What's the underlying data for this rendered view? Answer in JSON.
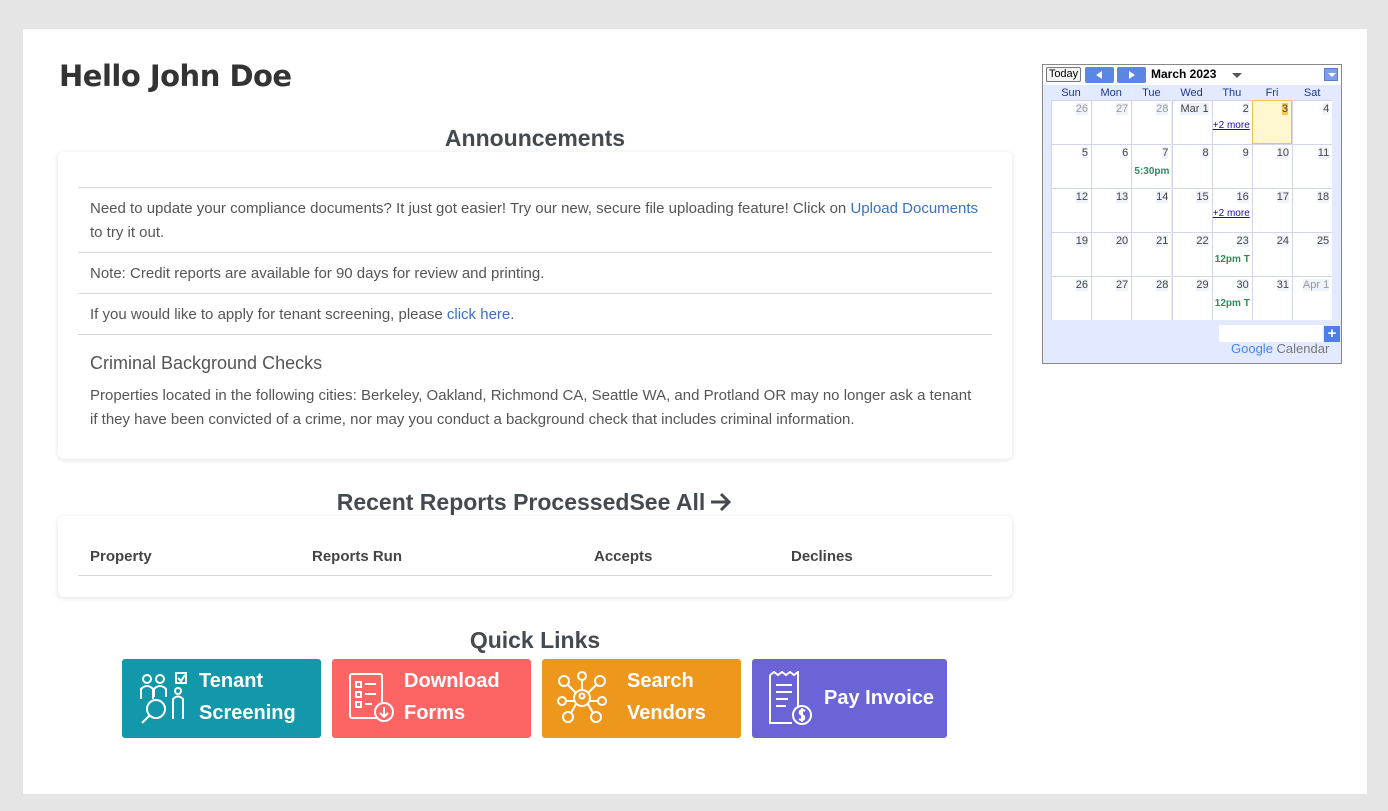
{
  "greeting": "Hello John Doe",
  "announcements": {
    "title": "Announcements",
    "item1_text_a": "Need to update your compliance documents? It just got easier! Try our new, secure file uploading feature! Click on ",
    "item1_link": "Upload Documents",
    "item1_text_b": "to try it out.",
    "item2_text": "Note: Credit reports are available for 90 days for review and printing.",
    "item3_text_a": "If you would like to apply for tenant screening, please ",
    "item3_link": "click here",
    "item3_text_b": ".",
    "criminal_title": "Criminal Background Checks",
    "criminal_text": "Properties located in the following cities: Berkeley, Oakland, Richmond CA, Seattle WA, and Protland OR may no longer ask a tenant if they have been convicted of a crime, nor may you conduct a background check that includes criminal information."
  },
  "reports": {
    "title": "Recent Reports Processed",
    "see_all": "See All",
    "columns": [
      "Property",
      "Reports Run",
      "Accepts",
      "Declines"
    ]
  },
  "quick_links": {
    "title": "Quick Links",
    "tenant_l1": "Tenant",
    "tenant_l2": "Screening",
    "download_l1": "Download",
    "download_l2": "Forms",
    "vendors_l1": "Search",
    "vendors_l2": "Vendors",
    "invoice": "Pay Invoice",
    "colors": {
      "tenant": "#1297ab",
      "download": "#fd6565",
      "vendors": "#ee971d",
      "invoice": "#6a64d7"
    }
  },
  "calendar": {
    "today_label": "Today",
    "month_label": "March 2023",
    "days_of_week": [
      "Sun",
      "Mon",
      "Tue",
      "Wed",
      "Thu",
      "Fri",
      "Sat"
    ],
    "weeks": [
      [
        {
          "d": "26",
          "o": true
        },
        {
          "d": "27",
          "o": true
        },
        {
          "d": "28",
          "o": true
        },
        {
          "d": "Mar 1"
        },
        {
          "d": "2",
          "more": "+2 more"
        },
        {
          "d": "3",
          "today": true
        },
        {
          "d": "4"
        }
      ],
      [
        {
          "d": "5"
        },
        {
          "d": "6"
        },
        {
          "d": "7",
          "ev": "5:30pm"
        },
        {
          "d": "8"
        },
        {
          "d": "9"
        },
        {
          "d": "10"
        },
        {
          "d": "11"
        }
      ],
      [
        {
          "d": "12"
        },
        {
          "d": "13"
        },
        {
          "d": "14"
        },
        {
          "d": "15"
        },
        {
          "d": "16",
          "more": "+2 more"
        },
        {
          "d": "17"
        },
        {
          "d": "18"
        }
      ],
      [
        {
          "d": "19"
        },
        {
          "d": "20"
        },
        {
          "d": "21"
        },
        {
          "d": "22"
        },
        {
          "d": "23",
          "ev": "12pm T"
        },
        {
          "d": "24"
        },
        {
          "d": "25"
        }
      ],
      [
        {
          "d": "26"
        },
        {
          "d": "27"
        },
        {
          "d": "28"
        },
        {
          "d": "29"
        },
        {
          "d": "30",
          "ev": "12pm T"
        },
        {
          "d": "31"
        },
        {
          "d": "Apr 1",
          "o": true
        }
      ]
    ],
    "add_label": "+",
    "brand_google": "Google",
    "brand_calendar": "Calendar"
  }
}
